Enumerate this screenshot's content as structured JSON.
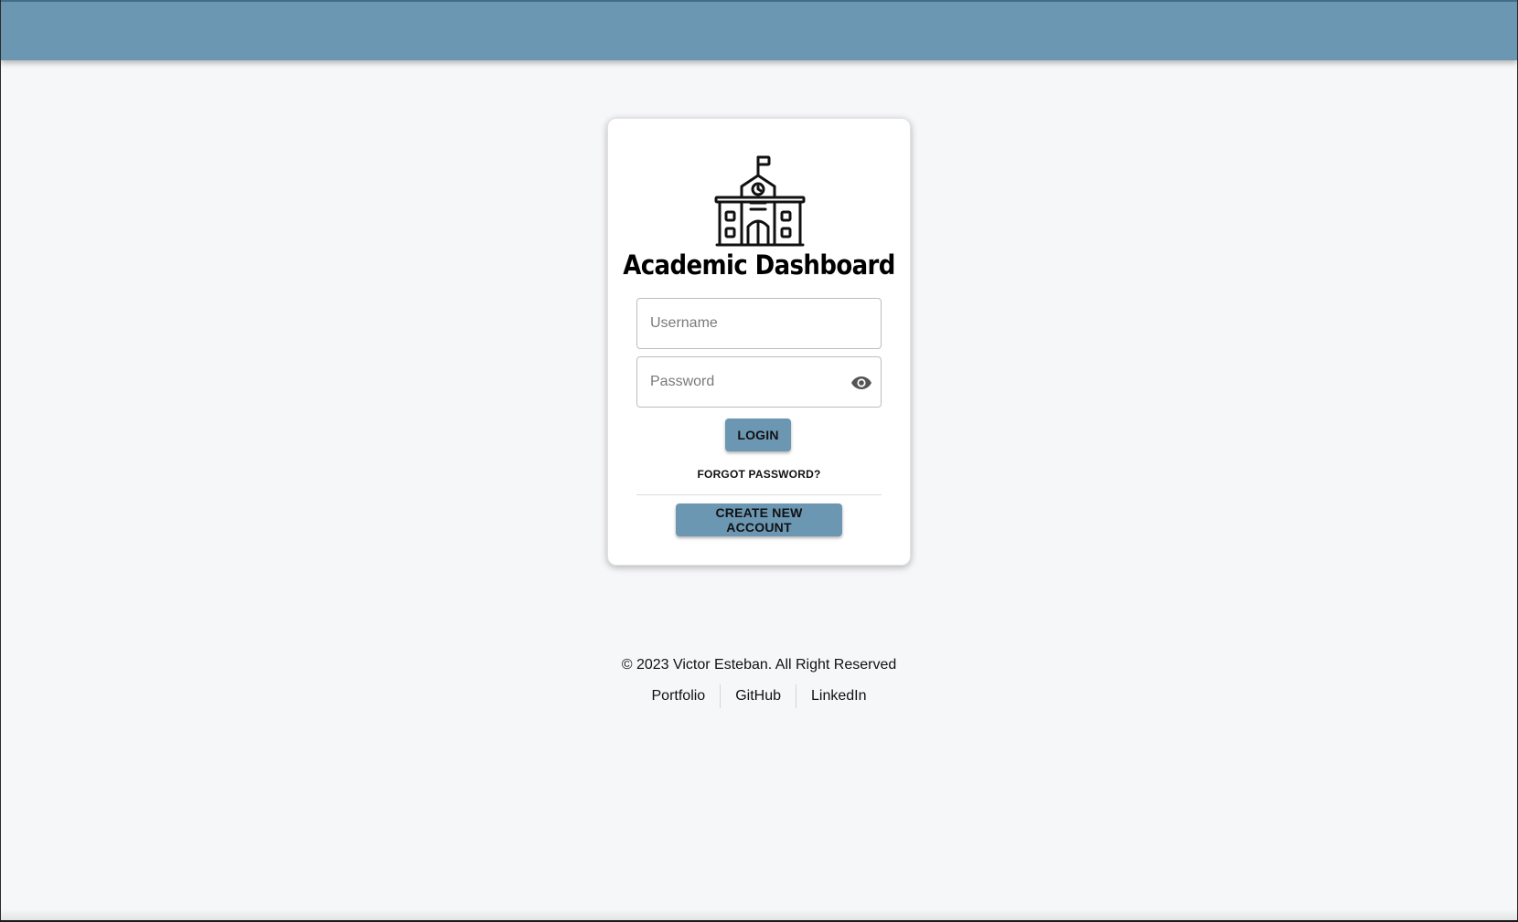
{
  "colors": {
    "accent": "#6c97b2",
    "background": "#f6f7f8",
    "card": "#ffffff",
    "text": "#111111"
  },
  "header": {},
  "login": {
    "logo_icon": "school-building-icon",
    "title": "Academic Dashboard",
    "username": {
      "placeholder": "Username",
      "value": ""
    },
    "password": {
      "placeholder": "Password",
      "value": "",
      "toggle_icon": "eye-icon"
    },
    "login_label": "LOGIN",
    "forgot_label": "FORGOT PASSWORD?",
    "create_label": "CREATE NEW ACCOUNT"
  },
  "footer": {
    "copyright": "© 2023 Victor Esteban. All Right Reserved",
    "links": [
      {
        "label": "Portfolio"
      },
      {
        "label": "GitHub"
      },
      {
        "label": "LinkedIn"
      }
    ]
  }
}
